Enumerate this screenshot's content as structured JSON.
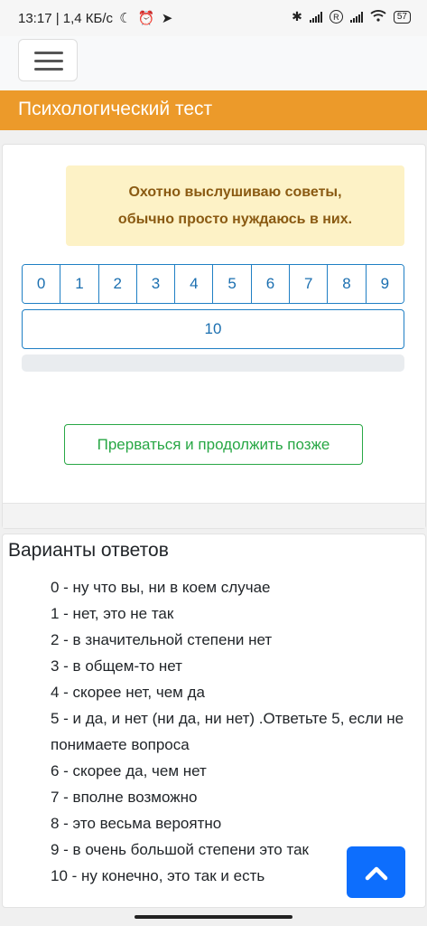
{
  "status_bar": {
    "time_speed": "13:17 | 1,4 КБ/с",
    "battery": "57",
    "sim_badge": "R"
  },
  "app": {
    "title": "Психологический тест"
  },
  "question": {
    "line1": "Охотно выслушиваю советы,",
    "line2": "обычно просто нуждаюсь в них."
  },
  "scale": {
    "options": [
      "0",
      "1",
      "2",
      "3",
      "4",
      "5",
      "6",
      "7",
      "8",
      "9"
    ],
    "last_option": "10"
  },
  "progress": {
    "value_percent": 0
  },
  "actions": {
    "pause_label": "Прерваться и продолжить позже"
  },
  "answers": {
    "heading": "Варианты ответов",
    "items": [
      "0 - ну что вы, ни в коем случае",
      "1 - нет, это не так",
      "2 - в значительной степени нет",
      "3 - в общем-то нет",
      "4 - скорее нет, чем да",
      "5 - и да, и нет (ни да, ни нет) .Ответьте 5, если не понимаете вопроса",
      "6 - скорее да, чем нет",
      "7 - вполне возможно",
      "8 - это весьма вероятно",
      "9 - в очень большой степени это так",
      "10 - ну конечно, это так и есть"
    ]
  },
  "icons": {
    "menu": "hamburger-icon",
    "scroll_top": "chevron-up-icon"
  },
  "colors": {
    "title_bar": "#ec9a2a",
    "scale_accent": "#1f7fc4",
    "pause_button": "#28a745",
    "scroll_top_button": "#0d6efd",
    "question_bg": "#fdf2c6"
  }
}
